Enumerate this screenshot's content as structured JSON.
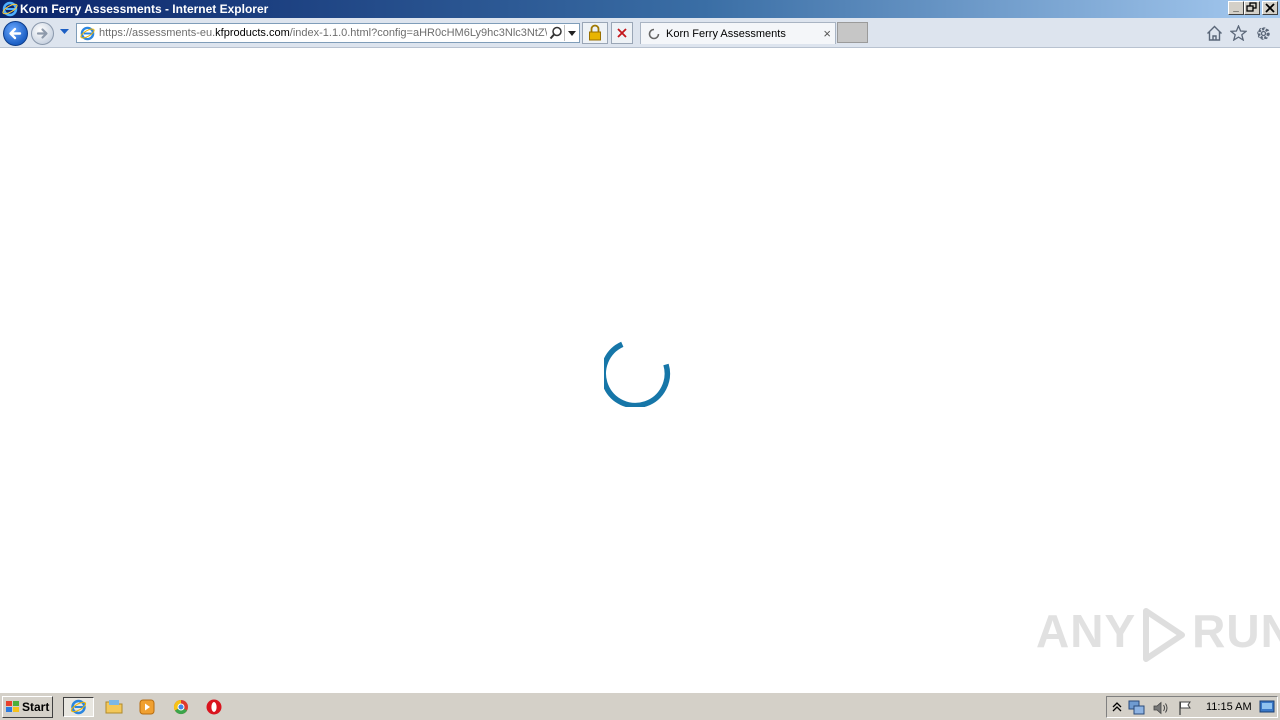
{
  "window": {
    "title": "Korn Ferry Assessments - Internet Explorer"
  },
  "address_bar": {
    "url_prefix": "https://assessments-eu.",
    "url_domain": "kfproducts.com",
    "url_suffix": "/index-1.1.0.html?config=aHR0cHM6Ly9hc3Nlc3NtZ\\"
  },
  "tabs": [
    {
      "title": "Korn Ferry Assessments",
      "close_label": "×"
    }
  ],
  "content": {
    "watermark": {
      "left": "ANY",
      "right": "RUN"
    }
  },
  "taskbar": {
    "start_label": "Start",
    "clock": "11:15 AM"
  },
  "colors": {
    "spinner": "#1676a8",
    "titlebar_start": "#0a246a",
    "titlebar_end": "#a6caf0"
  },
  "icons": {
    "app": "internet-explorer-icon",
    "navigation": [
      "back-arrow-icon",
      "forward-arrow-icon",
      "dropdown-icon"
    ],
    "address": [
      "site-ie-icon",
      "search-icon",
      "dropdown-icon",
      "lock-icon",
      "stop-icon"
    ],
    "toolbar": [
      "home-icon",
      "favorites-star-icon",
      "gear-icon"
    ],
    "taskbar": [
      "windows-flag-icon",
      "internet-explorer-icon",
      "folder-icon",
      "media-player-icon",
      "chrome-icon",
      "opera-icon"
    ],
    "tray": [
      "show-hidden-icons-icon",
      "network-icon",
      "volume-icon",
      "action-center-flag-icon",
      "show-desktop-icon"
    ]
  }
}
